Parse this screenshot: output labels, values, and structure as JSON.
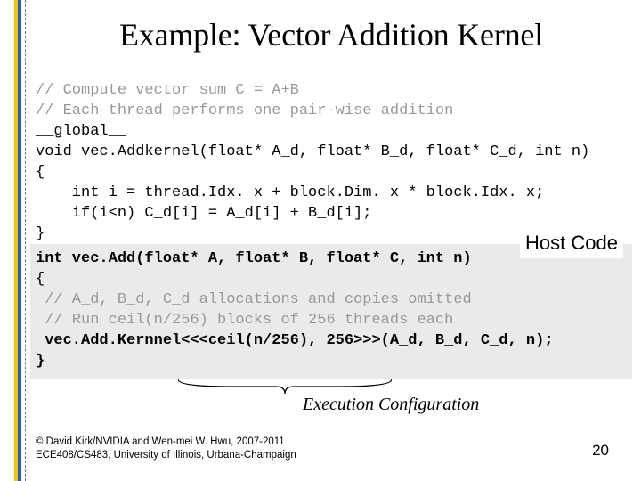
{
  "title": "Example: Vector Addition Kernel",
  "code": {
    "c1": "// Compute vector sum C = A+B",
    "c2": "// Each thread performs one pair-wise addition",
    "c3": "__global__",
    "c4": "void vec.Addkernel(float* A_d, float* B_d, float* C_d, int n)",
    "c5": "{",
    "c6": "    int i = thread.Idx. x + block.Dim. x * block.Idx. x;",
    "c7": "    if(i<n) C_d[i] = A_d[i] + B_d[i];",
    "c8": "}",
    "h1a": "int vec.Add(float* A, float* B, float* C, int n)",
    "h2": "{",
    "h3": " // A_d, B_d, C_d allocations and copies omitted",
    "h4": " // Run ceil(n/256) blocks of 256 threads each",
    "h5a": " vec.Add.Kernnel<<<",
    "h5b": "ceil(n/256), 256",
    "h5c": ">>>(A_d, B_d, C_d, n);",
    "h6": "}"
  },
  "host_label": "Host Code",
  "exec_config": "Execution Configuration",
  "footer_l1": "© David Kirk/NVIDIA and Wen-mei W. Hwu, 2007-2011",
  "footer_l2": "ECE408/CS483, University of Illinois, Urbana-Champaign",
  "page_number": "20"
}
